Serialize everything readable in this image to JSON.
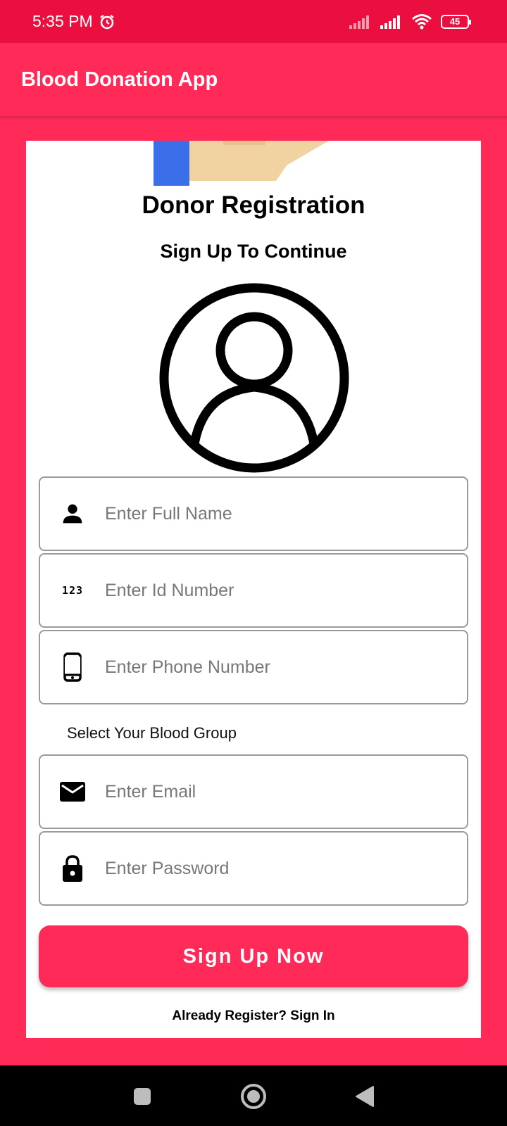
{
  "status_bar": {
    "time": "5:35 PM",
    "battery": "45",
    "icons": [
      "alarm-icon",
      "signal-icon",
      "signal-icon",
      "wifi-icon",
      "battery-icon"
    ]
  },
  "app_bar": {
    "title": "Blood Donation App"
  },
  "form": {
    "title": "Donor Registration",
    "subtitle": "Sign Up To Continue",
    "fields": {
      "full_name": {
        "placeholder": "Enter Full Name",
        "icon": "person-icon"
      },
      "id_number": {
        "placeholder": "Enter Id Number",
        "icon": "numbers-icon"
      },
      "phone": {
        "placeholder": "Enter Phone Number",
        "icon": "phone-icon"
      },
      "email": {
        "placeholder": "Enter Email",
        "icon": "mail-icon"
      },
      "password": {
        "placeholder": "Enter Password",
        "icon": "lock-icon"
      }
    },
    "numbers_icon_text": "123",
    "blood_group_label": "Select Your Blood Group",
    "signup_button": "Sign Up Now",
    "signin_link": "Already Register? Sign In"
  },
  "colors": {
    "primary": "#FF2A57",
    "status_bar": "#EB0F3F"
  }
}
